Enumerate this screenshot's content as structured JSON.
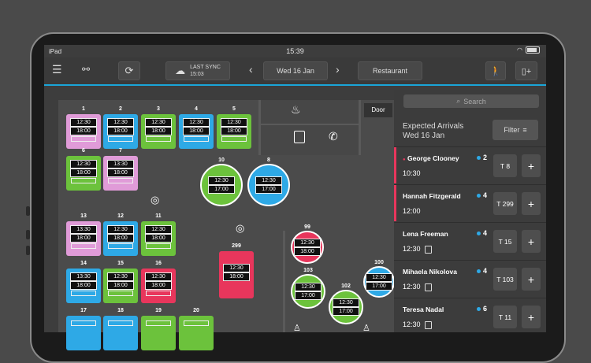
{
  "status_bar": {
    "device": "iPad",
    "time": "15:39"
  },
  "toolbar": {
    "sync_label": "LAST SYNC",
    "sync_time": "15:03",
    "date": "Wed 16 Jan",
    "area": "Restaurant"
  },
  "floor": {
    "door_label": "Door",
    "tables": [
      {
        "id": "1",
        "color": "pink",
        "times": [
          "12:30",
          "18:00"
        ]
      },
      {
        "id": "2",
        "color": "blue",
        "times": [
          "12:30",
          "18:00"
        ]
      },
      {
        "id": "3",
        "color": "green",
        "times": [
          "12:30",
          "18:00"
        ]
      },
      {
        "id": "4",
        "color": "blue",
        "times": [
          "12:30",
          "18:00"
        ]
      },
      {
        "id": "5",
        "color": "green",
        "times": [
          "12:30",
          "18:00"
        ]
      },
      {
        "id": "6",
        "color": "green",
        "times": [
          "12:30",
          "18:00"
        ]
      },
      {
        "id": "7",
        "color": "pink",
        "times": [
          "13:30",
          "18:00"
        ]
      },
      {
        "id": "13",
        "color": "pink",
        "times": [
          "13:30",
          "18:00"
        ]
      },
      {
        "id": "12",
        "color": "blue",
        "times": [
          "12:30",
          "18:00"
        ]
      },
      {
        "id": "11",
        "color": "green",
        "times": [
          "12:30",
          "18:00"
        ]
      },
      {
        "id": "14",
        "color": "blue",
        "times": [
          "13:30",
          "18:00"
        ]
      },
      {
        "id": "15",
        "color": "green",
        "times": [
          "12:30",
          "18:00"
        ]
      },
      {
        "id": "16",
        "color": "red",
        "times": [
          "12:30",
          "18:00"
        ]
      },
      {
        "id": "17",
        "color": "blue",
        "times": []
      },
      {
        "id": "18",
        "color": "blue",
        "times": []
      },
      {
        "id": "19",
        "color": "green",
        "times": []
      },
      {
        "id": "20",
        "color": "green",
        "times": []
      },
      {
        "id": "10",
        "color": "green",
        "times": [
          "12:30",
          "17:00"
        ]
      },
      {
        "id": "8",
        "color": "blue",
        "times": [
          "12:30",
          "17:00"
        ]
      },
      {
        "id": "299",
        "color": "red",
        "times": [
          "12:30",
          "18:00"
        ]
      },
      {
        "id": "99",
        "color": "red",
        "times": [
          "12:30",
          "18:00"
        ]
      },
      {
        "id": "103",
        "color": "green",
        "times": [
          "12:30",
          "17:00"
        ]
      },
      {
        "id": "102",
        "color": "green",
        "times": [
          "12:30",
          "17:00"
        ]
      },
      {
        "id": "100",
        "color": "blue",
        "times": [
          "12:30",
          "17:00"
        ]
      }
    ]
  },
  "panel": {
    "search_placeholder": "Search",
    "title_line1": "Expected Arrivals",
    "title_line2": "Wed 16 Jan",
    "filter_label": "Filter",
    "guests": [
      {
        "name": "George Clooney",
        "party": "2",
        "time": "10:30",
        "table": "T 8",
        "note": false,
        "flag": "red"
      },
      {
        "name": "Hannah Fitzgerald",
        "party": "4",
        "time": "12:00",
        "table": "T 299",
        "note": false,
        "flag": "red"
      },
      {
        "name": "Lena Freeman",
        "party": "4",
        "time": "12:30",
        "table": "T 15",
        "note": true,
        "flag": "none"
      },
      {
        "name": "Mihaela Nikolova",
        "party": "4",
        "time": "12:30",
        "table": "T 103",
        "note": true,
        "flag": "none"
      },
      {
        "name": "Teresa Nadal",
        "party": "6",
        "time": "12:30",
        "table": "T 11",
        "note": true,
        "flag": "none"
      }
    ]
  },
  "colors": {
    "pink": "#e09bd8",
    "blue": "#2ea9e6",
    "green": "#6cc23c",
    "red": "#e8365c",
    "accent": "#1aa5d8"
  }
}
